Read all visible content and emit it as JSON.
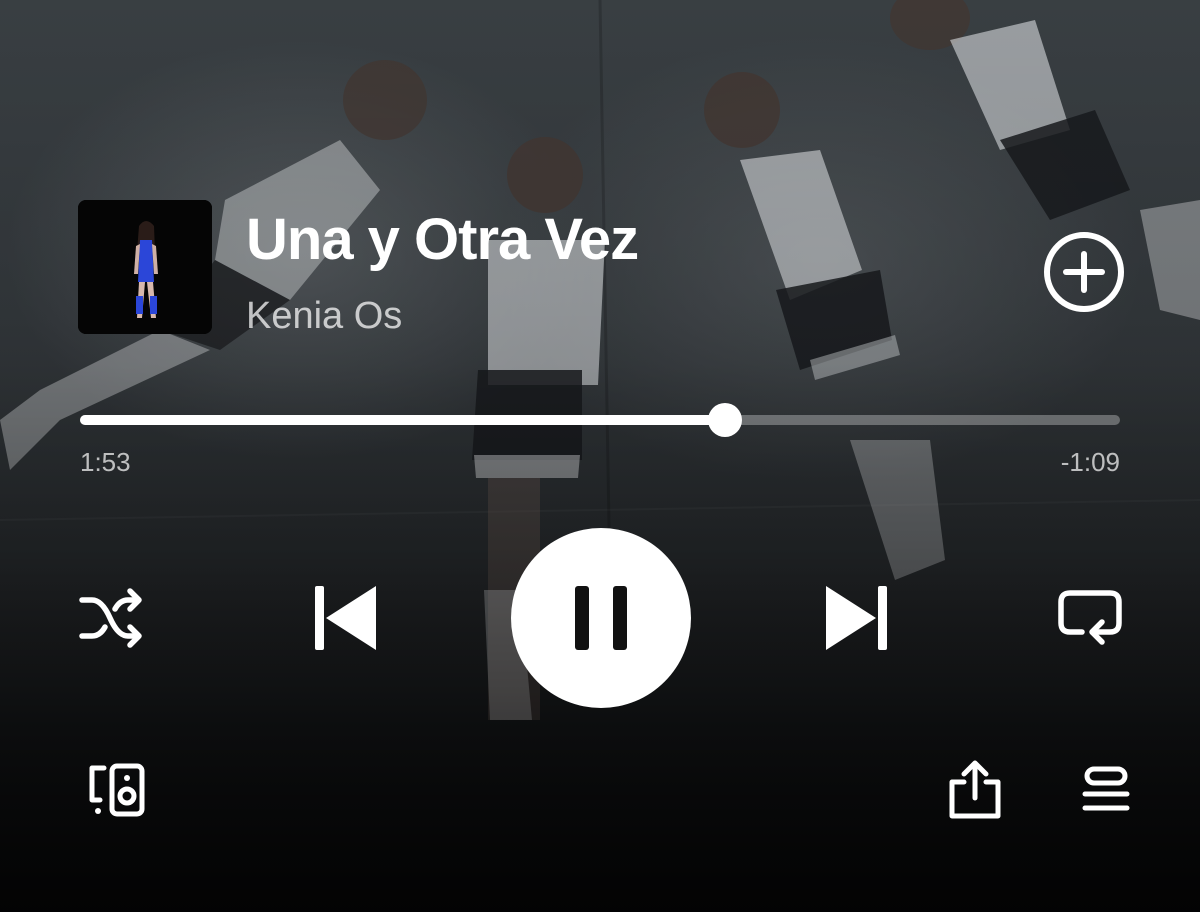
{
  "track": {
    "title": "Una y Otra Vez",
    "artist": "Kenia Os",
    "liked": false
  },
  "playback": {
    "elapsed": "1:53",
    "remaining": "-1:09",
    "progress_fraction": 0.62,
    "state": "playing",
    "shuffle": false,
    "repeat": "off"
  },
  "icons": {
    "add": "plus-circle-icon",
    "shuffle": "shuffle-icon",
    "previous": "skip-previous-icon",
    "play_pause": "pause-icon",
    "next": "skip-next-icon",
    "repeat": "repeat-icon",
    "devices": "connect-device-icon",
    "share": "share-icon",
    "queue": "queue-icon"
  },
  "colors": {
    "foreground": "#ffffff",
    "progress_rest": "rgba(255,255,255,0.30)",
    "background_top": "#3c4246",
    "background_bottom": "#0c0d0e"
  }
}
